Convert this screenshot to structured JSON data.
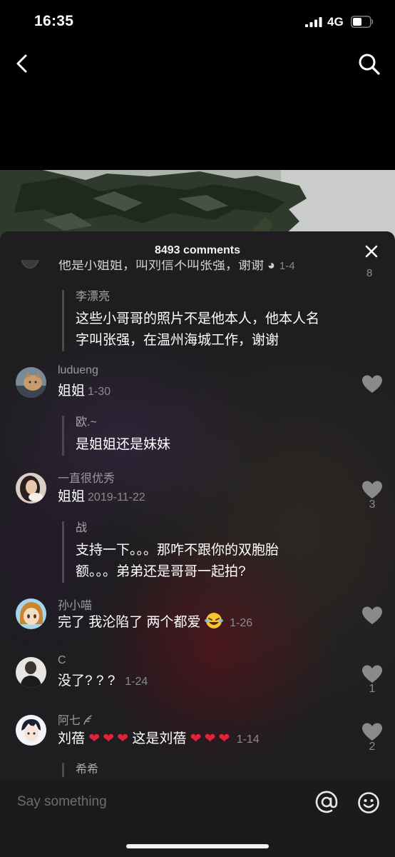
{
  "status_bar": {
    "time": "16:35",
    "network": "4G"
  },
  "sheet": {
    "title": "8493 comments"
  },
  "partial_comment": {
    "text": "他是小姐姐，叫刘信不叫张强，谢谢",
    "date": "1-4",
    "likes": "8"
  },
  "comments": [
    {
      "username": "",
      "text": "",
      "date": "",
      "likes": "",
      "reply": {
        "username": "李漂亮",
        "text_line1": "这些小哥哥的照片不是他本人，他本人名",
        "text_line2": "字叫张强，在温州海城工作，谢谢"
      }
    },
    {
      "username": "ludueng",
      "text": "姐姐",
      "date": "1-30",
      "likes": "",
      "reply": {
        "username": "欧.~",
        "text_line1": "是姐姐还是妹妹"
      }
    },
    {
      "username": "一直很优秀",
      "text": "姐姐",
      "date": "2019-11-22",
      "likes": "3",
      "reply": {
        "username": "战",
        "text_line1": "支持一下。。。那咋不跟你的双胞胎",
        "text_line2": "额。。。弟弟还是哥哥一起拍?"
      }
    },
    {
      "username": "孙小喵",
      "text": "完了 我沦陷了 两个都爱",
      "date": "1-26",
      "likes": ""
    },
    {
      "username": "C",
      "text": "没了? ? ?",
      "date": "1-24",
      "likes": "1"
    },
    {
      "username": "阿七",
      "text_before": "刘蓓",
      "text_middle": "这是刘蓓",
      "date": "1-14",
      "likes": "2",
      "reply": {
        "username": "希希"
      }
    }
  ],
  "input": {
    "placeholder": "Say something"
  },
  "icons": {
    "back": "chevron-left-icon",
    "search": "search-icon",
    "close": "close-icon",
    "heart": "heart-icon",
    "at": "at-icon",
    "emoji": "smiley-icon"
  },
  "colors": {
    "background": "#000000",
    "sheet": "#1e1d1f",
    "heart": "#e0223a",
    "muted_text": "#8b8b8b"
  }
}
